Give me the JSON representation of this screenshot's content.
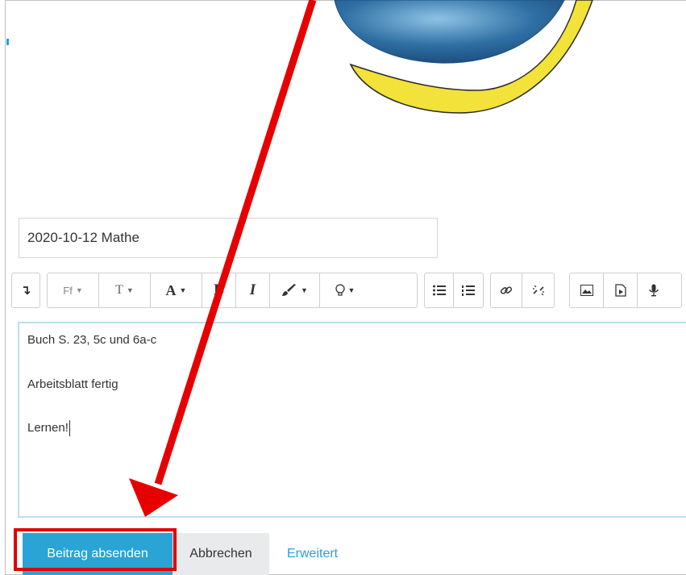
{
  "subject": {
    "value": "2020-10-12 Mathe"
  },
  "toolbar": {
    "items": [
      {
        "name": "expand-toolbar-button",
        "icon": "arrow-down-to-line-icon",
        "glyph": "↴"
      },
      {
        "name": "font-family-button",
        "icon": "font-family-icon",
        "glyph": "Ff"
      },
      {
        "name": "font-size-button",
        "icon": "font-size-icon",
        "glyph": "T"
      },
      {
        "name": "font-color-button",
        "icon": "font-color-icon",
        "glyph": "A"
      },
      {
        "name": "bold-button",
        "icon": "bold-icon",
        "glyph": "B"
      },
      {
        "name": "italic-button",
        "icon": "italic-icon",
        "glyph": "I"
      },
      {
        "name": "highlight-button",
        "icon": "paintbrush-icon",
        "glyph": "🖌"
      },
      {
        "name": "styles-button",
        "icon": "lightbulb-icon",
        "glyph": "💡"
      },
      {
        "name": "bullet-list-button",
        "icon": "bullet-list-icon",
        "glyph": "☰"
      },
      {
        "name": "numbered-list-button",
        "icon": "numbered-list-icon",
        "glyph": "☰"
      },
      {
        "name": "link-button",
        "icon": "link-icon",
        "glyph": "🔗"
      },
      {
        "name": "unlink-button",
        "icon": "unlink-icon",
        "glyph": "⛓"
      },
      {
        "name": "image-button",
        "icon": "image-icon",
        "glyph": "🖼"
      },
      {
        "name": "media-button",
        "icon": "media-file-icon",
        "glyph": "▶"
      },
      {
        "name": "record-audio-button",
        "icon": "microphone-icon",
        "glyph": "🎤"
      }
    ]
  },
  "editor": {
    "lines": [
      "Buch S. 23, 5c und 6a-c",
      "Arbeitsblatt fertig",
      "Lernen!"
    ]
  },
  "actions": {
    "submit_label": "Beitrag absenden",
    "cancel_label": "Abbrechen",
    "advanced_label": "Erweitert"
  },
  "colors": {
    "primary": "#2aa4d5",
    "annotation_red": "#e10000",
    "logo_blue": "#2f6fa3",
    "logo_yellow": "#f2e23a"
  }
}
